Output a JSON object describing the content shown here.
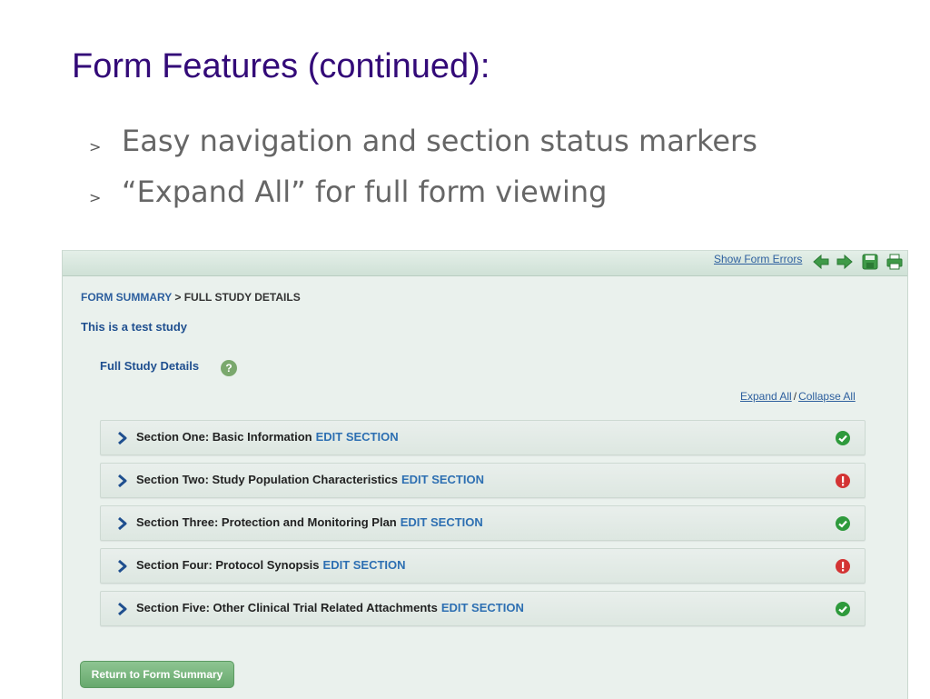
{
  "slide": {
    "title": "Form Features (continued):",
    "bullets": [
      {
        "marker": ">",
        "text": "Easy navigation and section status markers"
      },
      {
        "marker": ">",
        "text": "“Expand All” for full form viewing"
      }
    ]
  },
  "toolbar": {
    "show_form_errors": "Show Form Errors",
    "icons": [
      "arrow-left-icon",
      "arrow-right-icon",
      "save-icon",
      "print-icon"
    ]
  },
  "breadcrumb": {
    "link": "FORM SUMMARY",
    "separator": ">",
    "current": "FULL STUDY DETAILS"
  },
  "study_name": "This is a test study",
  "details_title": "Full Study Details",
  "help_icon": "?",
  "expand": {
    "expand_all": "Expand All",
    "separator": "/",
    "collapse_all": "Collapse All"
  },
  "sections": [
    {
      "title": "Section One: Basic Information",
      "edit": "EDIT SECTION",
      "status": "complete"
    },
    {
      "title": "Section Two: Study Population Characteristics",
      "edit": "EDIT SECTION",
      "status": "error"
    },
    {
      "title": "Section Three: Protection and Monitoring Plan",
      "edit": "EDIT SECTION",
      "status": "complete"
    },
    {
      "title": "Section Four: Protocol Synopsis",
      "edit": "EDIT SECTION",
      "status": "error"
    },
    {
      "title": "Section Five: Other Clinical Trial Related Attachments",
      "edit": "EDIT SECTION",
      "status": "complete"
    }
  ],
  "return_button": "Return to Form Summary",
  "colors": {
    "title": "#330a78",
    "link": "#2d5f9e",
    "status_complete": "#2e9a3c",
    "status_error": "#d33434",
    "button": "#6aab70"
  }
}
